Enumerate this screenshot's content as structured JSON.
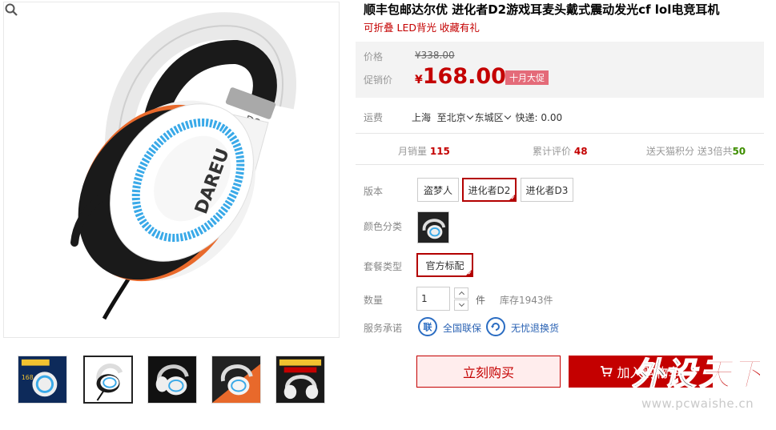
{
  "product": {
    "title": "顺丰包邮达尔优 进化者D2游戏耳麦头戴式震动发光cf lol电竞耳机",
    "subtitle": "可折叠 LED背光 收藏有礼"
  },
  "price": {
    "original_label": "价格",
    "original_value": "¥338.00",
    "promo_label": "促销价",
    "currency": "¥",
    "promo_value": "168.00",
    "promo_tag": "十月大促"
  },
  "shipping": {
    "label": "运费",
    "origin": "上海",
    "dest_city": "至北京",
    "dest_district": "东城区",
    "method": "快递: 0.00"
  },
  "stats": {
    "monthly_sales_label": "月销量",
    "monthly_sales": "115",
    "reviews_label": "累计评价",
    "reviews": "48",
    "points_label": "送天猫积分 送3倍共",
    "points": "50"
  },
  "options": {
    "version_label": "版本",
    "versions": [
      "盗梦人",
      "进化者D2",
      "进化者D3"
    ],
    "selected_version": "进化者D2",
    "color_label": "颜色分类",
    "package_label": "套餐类型",
    "package_value": "官方标配"
  },
  "quantity": {
    "label": "数量",
    "value": "1",
    "unit": "件",
    "stock": "库存1943件"
  },
  "service": {
    "label": "服务承诺",
    "items": [
      {
        "icon": "联",
        "text": "全国联保"
      },
      {
        "icon": "无",
        "text": "无忧退换货"
      }
    ]
  },
  "actions": {
    "buy_now": "立刻购买",
    "add_cart": "加入购物车"
  },
  "watermark": {
    "logo": "外设天下",
    "url": "www.pcwaishe.cn"
  },
  "colors": {
    "accent": "#c40000",
    "promo_tag": "#e46b79",
    "service_blue": "#2a6cc2",
    "price_bg": "#f3f3f3"
  }
}
